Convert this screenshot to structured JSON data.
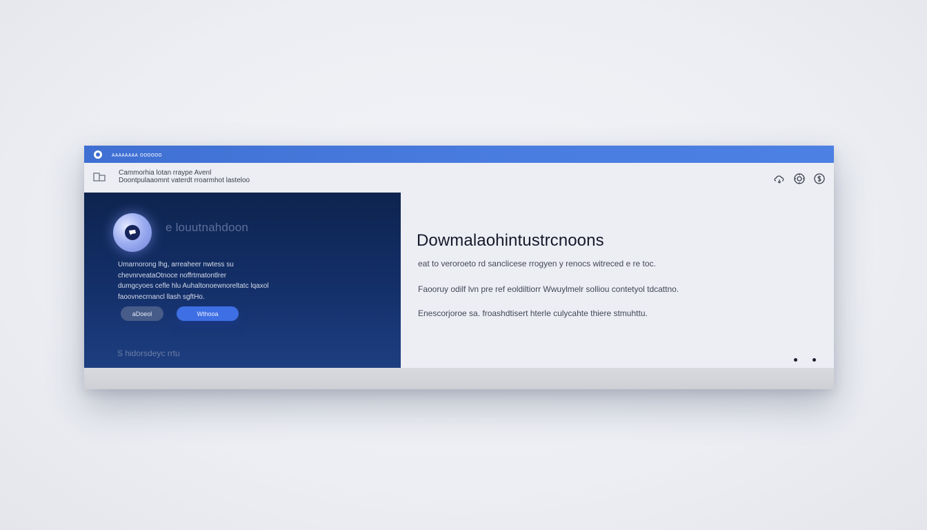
{
  "window": {
    "title": "ᴀᴀᴀᴀᴀᴀᴀᴀ ᴏᴏᴏᴏᴏᴏ"
  },
  "toolbar": {
    "breadcrumb_line1": "Cammorhia lotan rraype Avenl",
    "breadcrumb_line2": "Doontpulaaomnt vaterdt rroarmhot lasteloo",
    "actions": [
      "cloud-icon",
      "settings-icon",
      "dollar-icon"
    ]
  },
  "left_panel": {
    "title": "e louutnahdoon",
    "description": [
      "Umarnorong lhg, arreaheer nwtess su",
      "chevnrveataOtnoce noffrtmatontlrer",
      "dumgcyoes cefle hlu Auhaltonoewnoreltatc lqaxol",
      "faoovnecrnancl llash sgftHo."
    ],
    "secondary_button": "aDoeol",
    "primary_button": "Wthooa",
    "footer_link": "S hidorsdeyc rrtu"
  },
  "right_panel": {
    "headline": "Dowmalaohintustrcnoons",
    "line1": "eat to veroroeto rd sanclicese rrogyen y renocs witreced e re toc.",
    "line2": "Faooruy odilf lvn pre ref eoldiltiorr Wwuylmelr solliou contetyol tdcattno.",
    "line3": "Enescorjoroe sa. froashdtisert hterle culycahte thiere stmuhttu."
  },
  "pager": {
    "pages": 2,
    "current": 1
  },
  "colors": {
    "titlebar": "#4a7de0",
    "left_panel": "#14306a",
    "primary_button": "#3e6fe4",
    "right_panel": "#eceef4"
  }
}
